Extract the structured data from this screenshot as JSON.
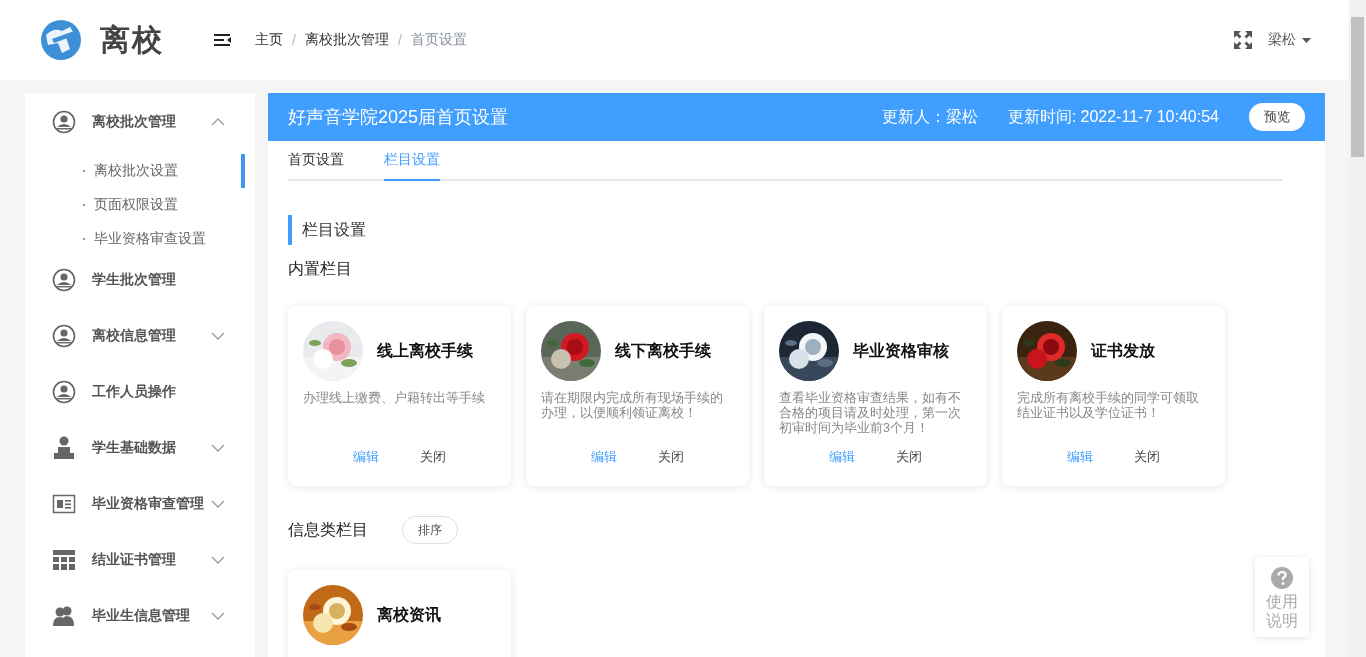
{
  "header": {
    "app_title": "离校",
    "breadcrumb": [
      {
        "label": "主页",
        "current": false,
        "separator": "/"
      },
      {
        "label": "离校批次管理",
        "current": false,
        "separator": "/"
      },
      {
        "label": "首页设置",
        "current": true
      }
    ],
    "user": "梁松"
  },
  "sidebar": {
    "items": [
      {
        "label": "离校批次管理",
        "kind": "group",
        "expanded": true,
        "children": [
          {
            "label": "离校批次设置",
            "selected": true
          },
          {
            "label": "页面权限设置",
            "selected": false
          },
          {
            "label": "毕业资格审查设置",
            "selected": false
          }
        ]
      },
      {
        "label": "学生批次管理",
        "kind": "link"
      },
      {
        "label": "离校信息管理",
        "kind": "group",
        "expanded": false
      },
      {
        "label": "工作人员操作",
        "kind": "link"
      },
      {
        "label": "学生基础数据",
        "kind": "group",
        "expanded": false
      },
      {
        "label": "毕业资格审查管理",
        "kind": "group",
        "expanded": false
      },
      {
        "label": "结业证书管理",
        "kind": "group",
        "expanded": false
      },
      {
        "label": "毕业生信息管理",
        "kind": "group",
        "expanded": false
      }
    ]
  },
  "panel": {
    "title": "好声音学院2025届首页设置",
    "updater": "更新人：梁松",
    "updated_at": "更新时间: 2022-11-7 10:40:54",
    "preview_button": "预览",
    "tabs": [
      {
        "label": "首页设置",
        "selected": false
      },
      {
        "label": "栏目设置",
        "selected": true
      }
    ],
    "section_title": "栏目设置",
    "builtin": {
      "heading": "内置栏目",
      "cards": [
        {
          "title": "线上离校手续",
          "description": "办理线上缴费、户籍转出等手续",
          "actions": [
            "编辑",
            "关闭"
          ]
        },
        {
          "title": "线下离校手续",
          "description": "请在期限内完成所有现场手续的办理，以便顺利领证离校！",
          "actions": [
            "编辑",
            "关闭"
          ]
        },
        {
          "title": "毕业资格审核",
          "description": "查看毕业资格审查结果，如有不合格的项目请及时处理，第一次初审时间为毕业前3个月！",
          "actions": [
            "编辑",
            "关闭"
          ]
        },
        {
          "title": "证书发放",
          "description": "完成所有离校手续的同学可领取结业证书以及学位证书！",
          "actions": [
            "编辑",
            "关闭"
          ]
        }
      ]
    },
    "info": {
      "heading": "信息类栏目",
      "sort_button": "排序",
      "cards": [
        {
          "title": "离校资讯"
        }
      ]
    }
  },
  "help_button": {
    "label": "使用说明"
  }
}
